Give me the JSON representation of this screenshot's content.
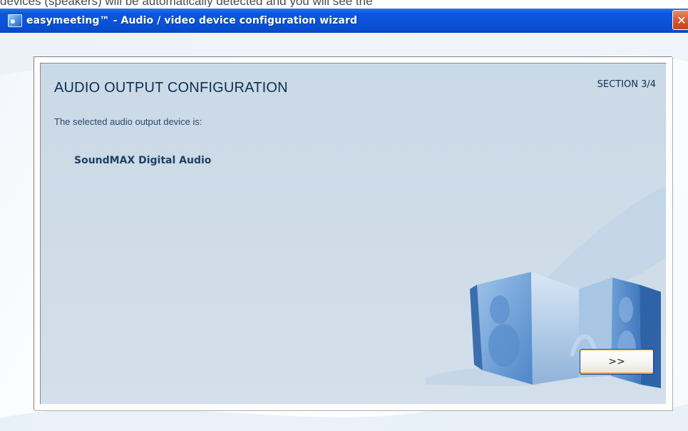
{
  "window": {
    "title": "easymeeting™ - Audio / video device configuration wizard",
    "close_label": "✕",
    "background_text": "devices (speakers) will be automatically detected and you will see the"
  },
  "wizard": {
    "heading": "AUDIO OUTPUT CONFIGURATION",
    "section": "SECTION 3/4",
    "prompt": "The selected audio output device is:",
    "device_name": "SoundMAX Digital Audio",
    "next_label": ">>"
  },
  "icons": {
    "app": "app-icon",
    "speakers": "speakers-illustration-icon"
  },
  "colors": {
    "titlebar": "#0a52d8",
    "panel": "#cfdce8",
    "heading_text": "#0f2f52",
    "close": "#d75a35",
    "button_accent": "#e8a530"
  }
}
